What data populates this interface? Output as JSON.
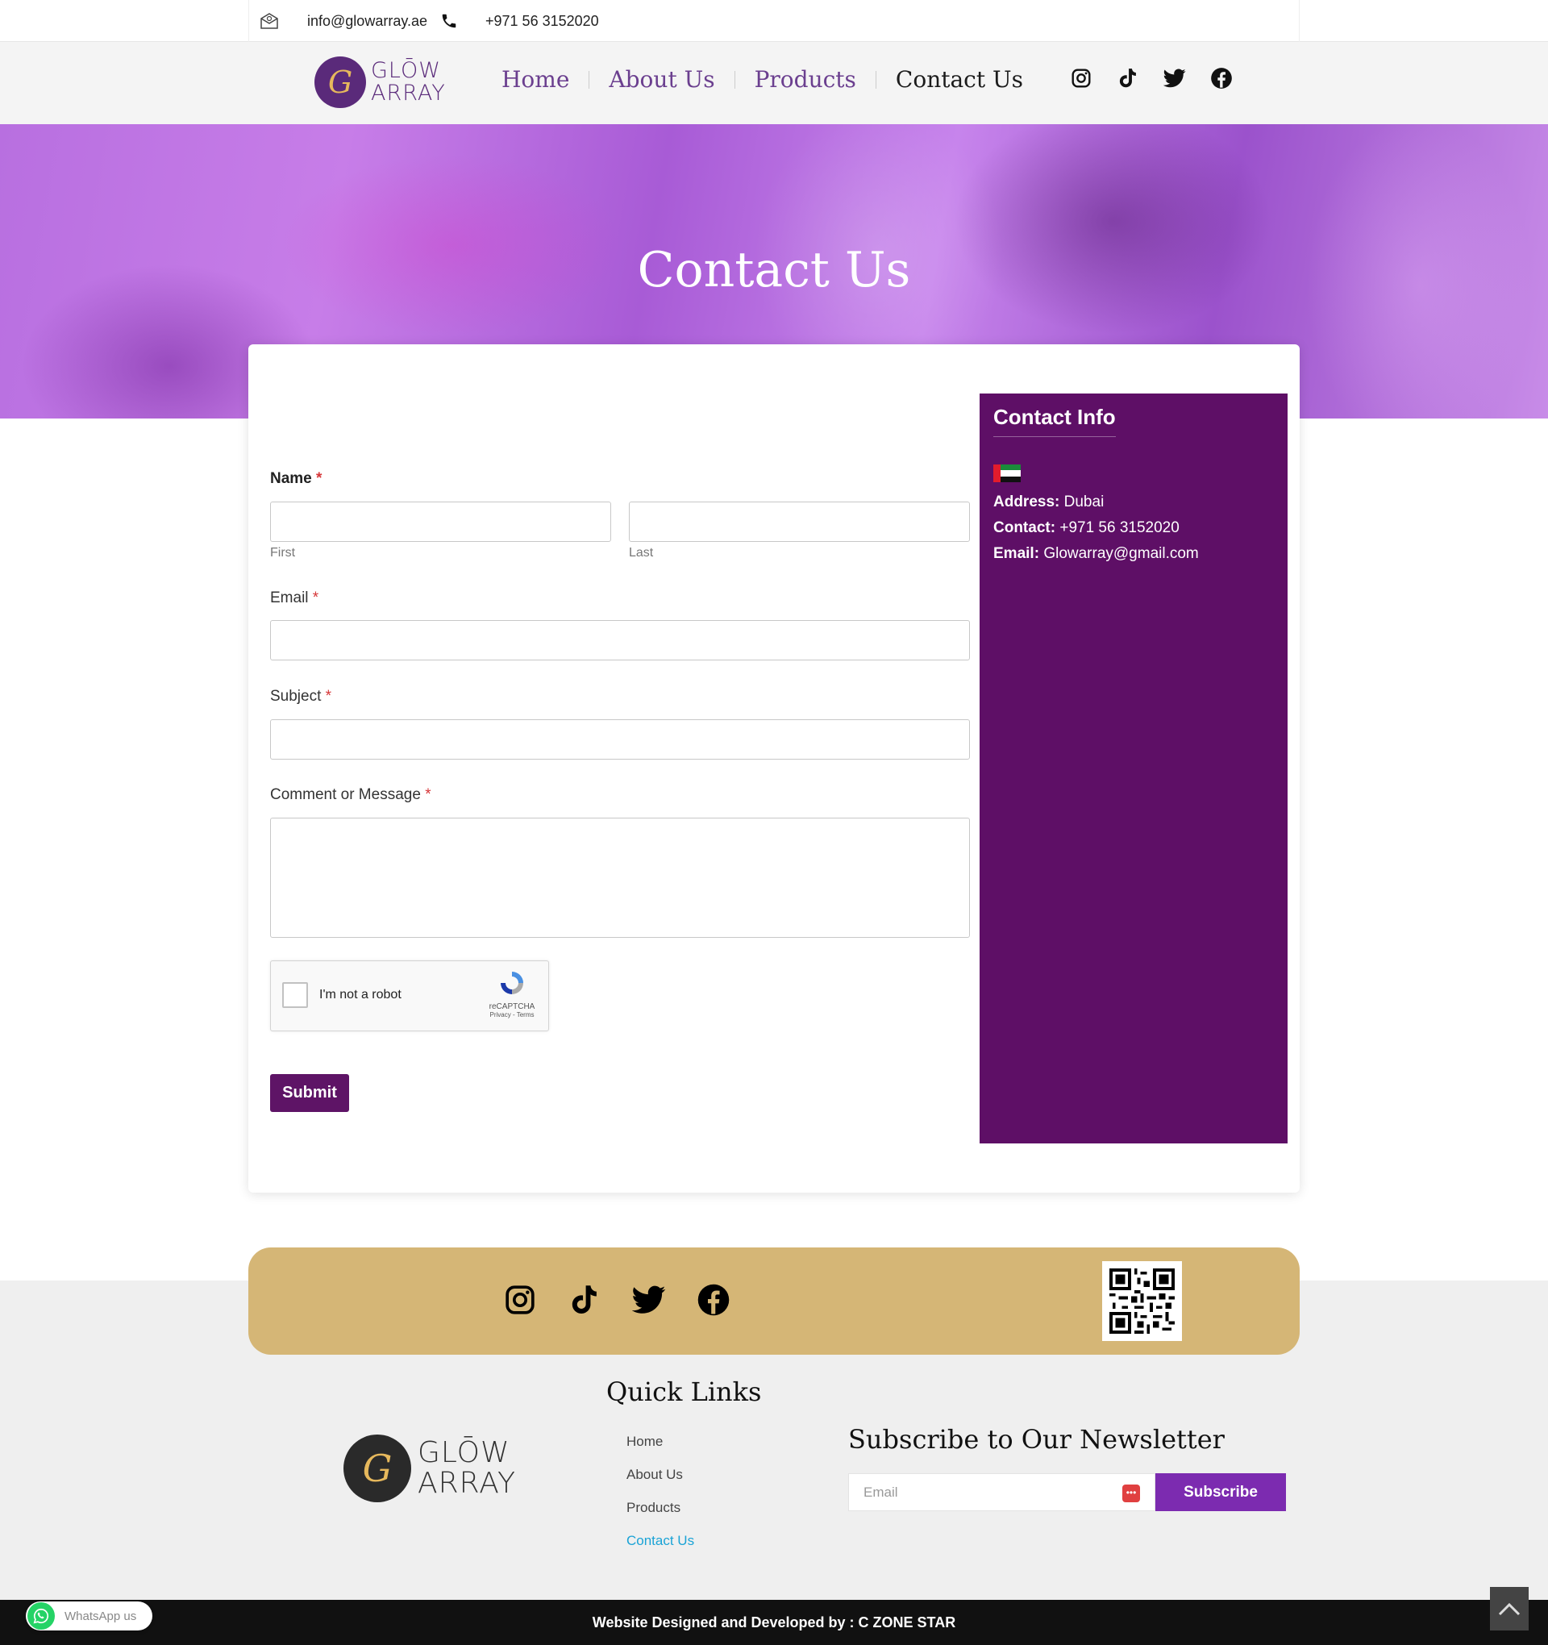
{
  "topbar": {
    "email": "info@glowarray.ae",
    "phone": "+971 56 3152020",
    "icons": [
      "mail-icon",
      "phone-icon"
    ]
  },
  "header": {
    "logo_mark": "G",
    "logo_line1": "GLŌW",
    "logo_line2": "ARRAY",
    "nav": [
      "Home",
      "About Us",
      "Products",
      "Contact Us"
    ],
    "active_nav": "Contact Us",
    "social_icons": [
      "instagram-icon",
      "tiktok-icon",
      "twitter-icon",
      "facebook-icon"
    ]
  },
  "hero": {
    "title": "Contact Us"
  },
  "form": {
    "name_label": "Name",
    "required_mark": "*",
    "first_sublabel": "First",
    "last_sublabel": "Last",
    "email_label": "Email",
    "subject_label": "Subject",
    "message_label": "Comment or Message",
    "captcha_text": "I'm not a robot",
    "captcha_brand": "reCAPTCHA",
    "captcha_links": "Privacy - Terms",
    "submit_label": "Submit"
  },
  "contact_info": {
    "title": "Contact Info",
    "address_label": "Address:",
    "address_value": "Dubai",
    "contact_label": "Contact:",
    "contact_value": "+971 56 3152020",
    "email_label": "Email:",
    "email_value": "Glowarray@gmail.com"
  },
  "footer": {
    "social_icons": [
      "instagram-icon",
      "tiktok-icon",
      "twitter-icon",
      "facebook-icon"
    ],
    "quick_links_title": "Quick Links",
    "quick_links": [
      "Home",
      "About Us",
      "Products",
      "Contact Us"
    ],
    "active_link": "Contact Us",
    "logo_mark": "G",
    "logo_line1": "GLŌW",
    "logo_line2": "ARRAY",
    "newsletter_title": "Subscribe to Our Newsletter",
    "newsletter_placeholder": "Email",
    "subscribe_label": "Subscribe",
    "credit": "Website Designed and Developed by : C ZONE STAR",
    "whatsapp_label": "WhatsApp us"
  },
  "colors": {
    "brand_purple": "#5e0f66",
    "accent_purple": "#7c2bb0",
    "gold": "#d5b676",
    "link_blue": "#1aa3d6"
  }
}
